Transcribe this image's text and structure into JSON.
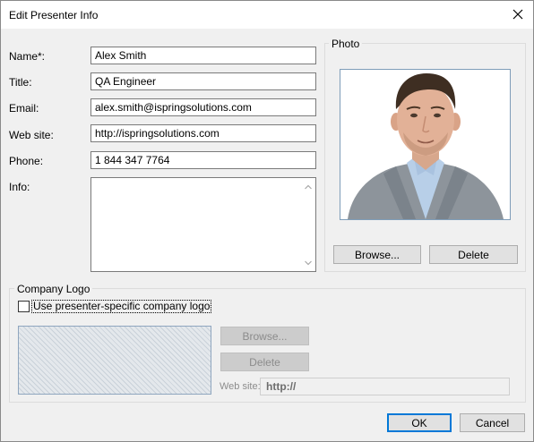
{
  "window": {
    "title": "Edit Presenter Info",
    "close_icon": "close-icon"
  },
  "form": {
    "name_label": "Name*:",
    "name_value": "Alex Smith",
    "title_label": "Title:",
    "title_value": "QA Engineer",
    "email_label": "Email:",
    "email_value": "alex.smith@ispringsolutions.com",
    "website_label": "Web site:",
    "website_value": "http://ispringsolutions.com",
    "phone_label": "Phone:",
    "phone_value": "1 844 347 7764",
    "info_label": "Info:",
    "info_value": ""
  },
  "photo": {
    "group_label": "Photo",
    "browse_label": "Browse...",
    "delete_label": "Delete"
  },
  "company_logo": {
    "group_label": "Company Logo",
    "checkbox_label": "Use presenter-specific company logo",
    "checkbox_checked": false,
    "browse_label": "Browse...",
    "delete_label": "Delete",
    "website_label": "Web site:",
    "website_value": "http://"
  },
  "footer": {
    "ok_label": "OK",
    "cancel_label": "Cancel"
  },
  "colors": {
    "accent": "#0078d7",
    "dialog_bg": "#f0f0f0"
  }
}
